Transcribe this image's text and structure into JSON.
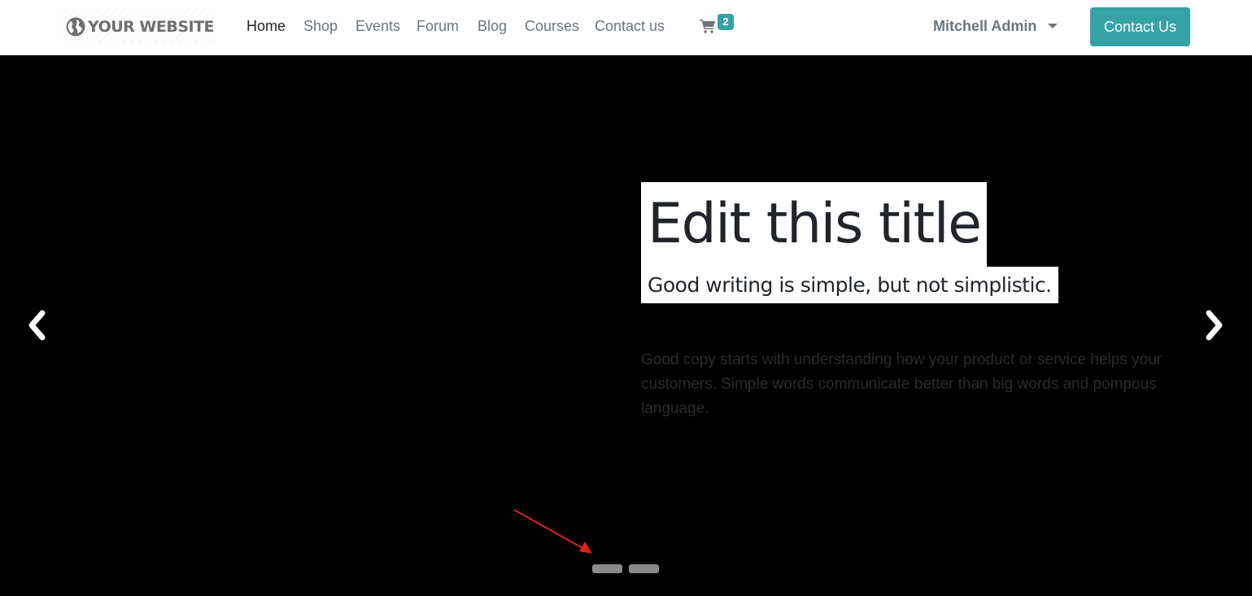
{
  "header": {
    "logo": {
      "text": "YOUR WEBSITE",
      "icon": "globe-icon"
    },
    "nav": [
      {
        "label": "Home",
        "active": true
      },
      {
        "label": "Shop",
        "active": false
      },
      {
        "label": "Events",
        "active": false
      },
      {
        "label": "Forum",
        "active": false
      },
      {
        "label": "Blog",
        "active": false
      },
      {
        "label": "Courses",
        "active": false
      },
      {
        "label": "Contact us",
        "active": false
      }
    ],
    "cart": {
      "icon": "cart-icon",
      "count": "2"
    },
    "user": {
      "name": "Mitchell Admin",
      "icon": "caret-down-icon"
    },
    "cta_label": "Contact Us"
  },
  "hero": {
    "title": "Edit this title",
    "subtitle": "Good writing is simple, but not simplistic.",
    "body": "Good copy starts with understanding how your product or service helps your customers. Simple words communicate better than big words and pompous language.",
    "prev_icon": "chevron-left-icon",
    "next_icon": "chevron-right-icon",
    "indicators": 2
  },
  "colors": {
    "accent": "#35a3a6",
    "nav_text": "#6c757d",
    "nav_active": "#212529",
    "hero_bg": "#000000",
    "indicator": "#8a8a8a",
    "annotation": "#e0201a"
  }
}
